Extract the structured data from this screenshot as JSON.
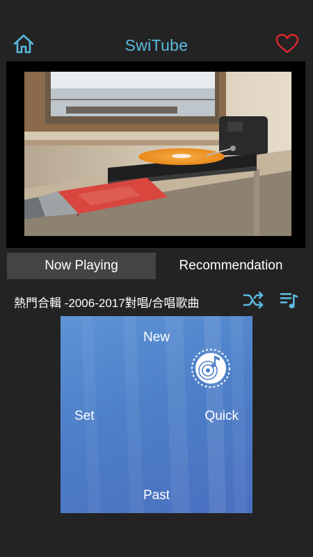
{
  "app": {
    "title": "SwiTube"
  },
  "icons": {
    "home": "home-icon",
    "favorite": "heart-icon",
    "shuffle": "shuffle-icon",
    "queue": "playlist-icon",
    "vinyl": "vinyl-record-icon"
  },
  "colors": {
    "accent": "#5ab9de",
    "favorite": "#e0262e",
    "background": "#232323",
    "tab_active": "#444444",
    "panel": "#5080c8"
  },
  "tabs": [
    {
      "label": "Now Playing",
      "active": true
    },
    {
      "label": "Recommendation",
      "active": false
    }
  ],
  "playlist": {
    "title": "熱門合輯 -2006-2017對唱/合唱歌曲"
  },
  "menu": {
    "new": "New",
    "set": "Set",
    "quick": "Quick",
    "past": "Past"
  }
}
